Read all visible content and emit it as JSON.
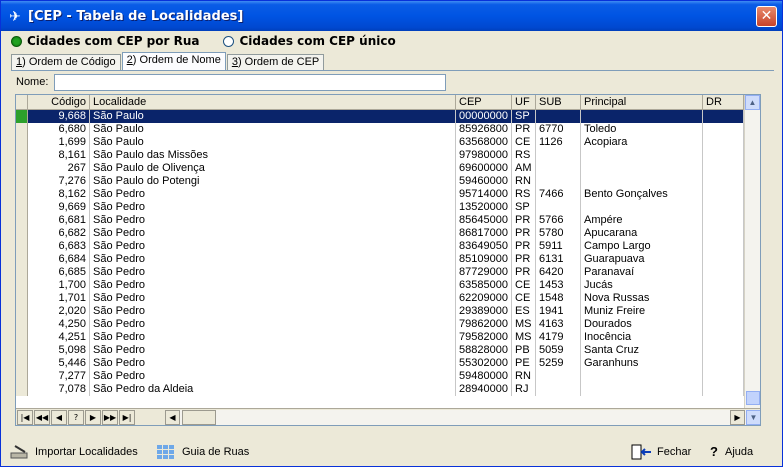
{
  "window": {
    "title": "[CEP - Tabela de Localidades]",
    "close_glyph": "✕"
  },
  "radios": [
    {
      "label": "Cidades com CEP por Rua",
      "checked": true
    },
    {
      "label": "Cidades com CEP único",
      "checked": false
    }
  ],
  "tabs": [
    {
      "key": "1",
      "label": ") Ordem de Código",
      "active": false
    },
    {
      "key": "2",
      "label": ") Ordem de Nome",
      "active": true
    },
    {
      "key": "3",
      "label": ") Ordem de CEP",
      "active": false
    }
  ],
  "search": {
    "label": "Nome:",
    "value": ""
  },
  "grid": {
    "columns": [
      "Código",
      "Localidade",
      "CEP",
      "UF",
      "SUB",
      "Principal",
      "DR"
    ],
    "rows": [
      [
        "9,668",
        "São Paulo",
        "00000000",
        "SP",
        "",
        "",
        ""
      ],
      [
        "6,680",
        "São Paulo",
        "85926800",
        "PR",
        "6770",
        "Toledo",
        ""
      ],
      [
        "1,699",
        "São Paulo",
        "63568000",
        "CE",
        "1126",
        "Acopiara",
        ""
      ],
      [
        "8,161",
        "São Paulo das Missões",
        "97980000",
        "RS",
        "",
        "",
        ""
      ],
      [
        "267",
        "São Paulo de Olivença",
        "69600000",
        "AM",
        "",
        "",
        ""
      ],
      [
        "7,276",
        "São Paulo do Potengi",
        "59460000",
        "RN",
        "",
        "",
        ""
      ],
      [
        "8,162",
        "São Pedro",
        "95714000",
        "RS",
        "7466",
        "Bento Gonçalves",
        ""
      ],
      [
        "9,669",
        "São Pedro",
        "13520000",
        "SP",
        "",
        "",
        ""
      ],
      [
        "6,681",
        "São Pedro",
        "85645000",
        "PR",
        "5766",
        "Ampére",
        ""
      ],
      [
        "6,682",
        "São Pedro",
        "86817000",
        "PR",
        "5780",
        "Apucarana",
        ""
      ],
      [
        "6,683",
        "São Pedro",
        "83649050",
        "PR",
        "5911",
        "Campo Largo",
        ""
      ],
      [
        "6,684",
        "São Pedro",
        "85109000",
        "PR",
        "6131",
        "Guarapuava",
        ""
      ],
      [
        "6,685",
        "São Pedro",
        "87729000",
        "PR",
        "6420",
        "Paranavaí",
        ""
      ],
      [
        "1,700",
        "São Pedro",
        "63585000",
        "CE",
        "1453",
        "Jucás",
        ""
      ],
      [
        "1,701",
        "São Pedro",
        "62209000",
        "CE",
        "1548",
        "Nova Russas",
        ""
      ],
      [
        "2,020",
        "São Pedro",
        "29389000",
        "ES",
        "1941",
        "Muniz Freire",
        ""
      ],
      [
        "4,250",
        "São Pedro",
        "79862000",
        "MS",
        "4163",
        "Dourados",
        ""
      ],
      [
        "4,251",
        "São Pedro",
        "79582000",
        "MS",
        "4179",
        "Inocência",
        ""
      ],
      [
        "5,098",
        "São Pedro",
        "58828000",
        "PB",
        "5059",
        "Santa Cruz",
        ""
      ],
      [
        "5,446",
        "São Pedro",
        "55302000",
        "PE",
        "5259",
        "Garanhuns",
        ""
      ],
      [
        "7,277",
        "São Pedro",
        "59480000",
        "RN",
        "",
        "",
        ""
      ],
      [
        "7,078",
        "São Pedro da Aldeia",
        "28940000",
        "RJ",
        "",
        "",
        ""
      ]
    ],
    "selected_row": 0
  },
  "navigator": [
    "|◀",
    "◀◀",
    "◀",
    "?",
    "▶",
    "▶▶",
    "▶|"
  ],
  "footer": {
    "import_label": "Importar Localidades",
    "streets_label": "Guia de Ruas",
    "close_label": "Fechar",
    "help_label": "Ajuda"
  }
}
